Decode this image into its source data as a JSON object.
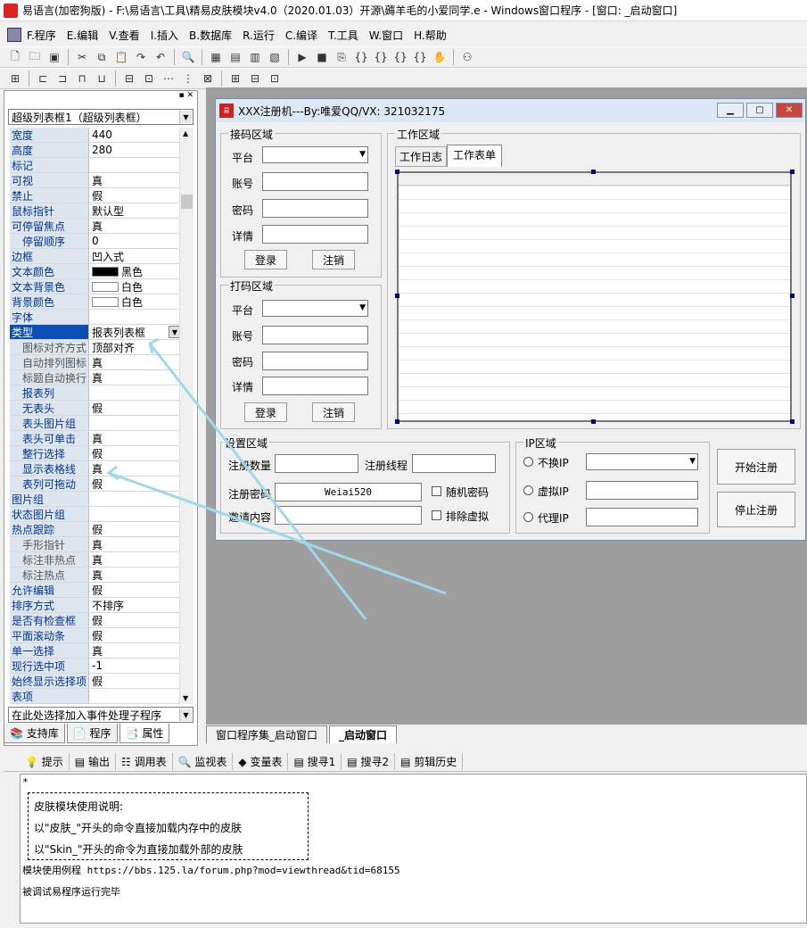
{
  "titlebar": {
    "text": "易语言(加密狗版) - F:\\易语言\\工具\\精易皮肤模块v4.0（2020.01.03）开源\\薅羊毛的小爱同学.e - Windows窗口程序 - [窗口: _启动窗口]"
  },
  "menu": [
    "F.程序",
    "E.编辑",
    "V.查看",
    "I.插入",
    "B.数据库",
    "R.运行",
    "C.编译",
    "T.工具",
    "W.窗口",
    "H.帮助"
  ],
  "properties": {
    "component_selector": "超级列表框1（超级列表框）",
    "rows": [
      {
        "name": "宽度",
        "value": "440"
      },
      {
        "name": "高度",
        "value": "280"
      },
      {
        "name": "标记",
        "value": ""
      },
      {
        "name": "可视",
        "value": "真"
      },
      {
        "name": "禁止",
        "value": "假"
      },
      {
        "name": "鼠标指针",
        "value": "默认型"
      },
      {
        "name": "可停留焦点",
        "value": "真"
      },
      {
        "name": "停留顺序",
        "value": "0",
        "indent": "subb"
      },
      {
        "name": "边框",
        "value": "凹入式"
      },
      {
        "name": "文本颜色",
        "value": "黑色",
        "swatch": "#000000"
      },
      {
        "name": "文本背景色",
        "value": "白色",
        "swatch": "#ffffff"
      },
      {
        "name": "背景颜色",
        "value": "白色",
        "swatch": "#ffffff"
      },
      {
        "name": "字体",
        "value": ""
      },
      {
        "name": "类型",
        "value": "报表列表框",
        "selected": true
      },
      {
        "name": "图标对齐方式",
        "value": "顶部对齐",
        "indent": "sub"
      },
      {
        "name": "自动排列图标",
        "value": "真",
        "indent": "sub"
      },
      {
        "name": "标题自动换行",
        "value": "真",
        "indent": "sub"
      },
      {
        "name": "报表列",
        "value": "",
        "indent": "subb"
      },
      {
        "name": "无表头",
        "value": "假",
        "indent": "subb"
      },
      {
        "name": "表头图片组",
        "value": "",
        "indent": "subb"
      },
      {
        "name": "表头可单击",
        "value": "真",
        "indent": "subb"
      },
      {
        "name": "整行选择",
        "value": "假",
        "indent": "subb"
      },
      {
        "name": "显示表格线",
        "value": "真",
        "indent": "subb"
      },
      {
        "name": "表列可拖动",
        "value": "假",
        "indent": "subb"
      },
      {
        "name": "图片组",
        "value": ""
      },
      {
        "name": "状态图片组",
        "value": ""
      },
      {
        "name": "热点跟踪",
        "value": "假"
      },
      {
        "name": "手形指针",
        "value": "真",
        "indent": "sub"
      },
      {
        "name": "标注非热点",
        "value": "真",
        "indent": "sub"
      },
      {
        "name": "标注热点",
        "value": "真",
        "indent": "sub"
      },
      {
        "name": "允许编辑",
        "value": "假"
      },
      {
        "name": "排序方式",
        "value": "不排序"
      },
      {
        "name": "是否有检查框",
        "value": "假"
      },
      {
        "name": "平面滚动条",
        "value": "假"
      },
      {
        "name": "单一选择",
        "value": "真"
      },
      {
        "name": "现行选中项",
        "value": "-1"
      },
      {
        "name": "始终显示选择项",
        "value": "假"
      },
      {
        "name": "表项",
        "value": ""
      }
    ],
    "event_selector": "在此处选择加入事件处理子程序",
    "tabs": [
      "支持库",
      "程序",
      "属性"
    ]
  },
  "form": {
    "title": "XXX注册机---By:唯爱QQ/VX:  321032175",
    "receive": {
      "title": "接码区域",
      "platform": "平台",
      "account": "账号",
      "password": "密码",
      "detail": "详情",
      "login": "登录",
      "logout": "注销"
    },
    "captcha": {
      "title": "打码区域",
      "platform": "平台",
      "account": "账号",
      "password": "密码",
      "detail": "详情",
      "login": "登录",
      "logout": "注销"
    },
    "work": {
      "title": "工作区域",
      "tabs": [
        "工作日志",
        "工作表单"
      ]
    },
    "settings": {
      "title": "设置区域",
      "reg_count": "注册数量",
      "reg_threads": "注册线程",
      "reg_password": "注册密码",
      "password_value": "Weiai520",
      "random_password": "随机密码",
      "invite": "邀请内容",
      "exclude_virtual": "排除虚拟"
    },
    "ip": {
      "title": "IP区域",
      "no_change": "不换IP",
      "virtual": "虚拟IP",
      "proxy": "代理IP"
    },
    "start": "开始注册",
    "stop": "停止注册"
  },
  "editor_tabs": [
    "窗口程序集_启动窗口",
    "_启动窗口"
  ],
  "output": {
    "tabs": [
      "提示",
      "输出",
      "调用表",
      "监视表",
      "变量表",
      "搜寻1",
      "搜寻2",
      "剪辑历史"
    ],
    "star": "*",
    "box_lines": [
      "皮肤模块使用说明:",
      "以\"皮肤_\"开头的命令直接加载内存中的皮肤",
      "以\"Skin_\"开头的命令为直接加载外部的皮肤"
    ],
    "line1": "模块使用例程 https://bbs.125.la/forum.php?mod=viewthread&tid=68155",
    "line2": "被调试易程序运行完毕"
  }
}
